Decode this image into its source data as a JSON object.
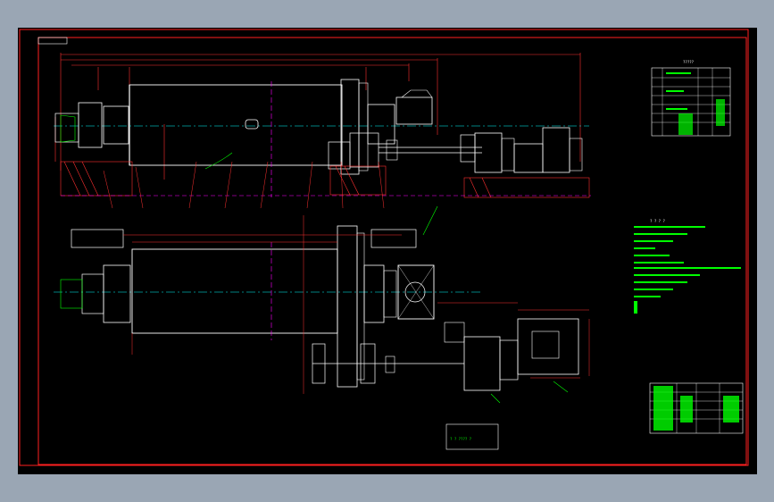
{
  "drawing": {
    "background": "#000000",
    "frame_color": "#ff2020",
    "line_colors": {
      "white": "#ffffff",
      "cyan": "#00ffff",
      "magenta": "#ff00ff",
      "red": "#ff3030",
      "green": "#00ff00",
      "yellow": "#ffff00"
    }
  },
  "parts_table": {
    "title": "?????"
  },
  "tech_notes": {
    "heading": "? ? ? ?"
  },
  "note_box": {
    "text": "? ? ???? ?"
  }
}
